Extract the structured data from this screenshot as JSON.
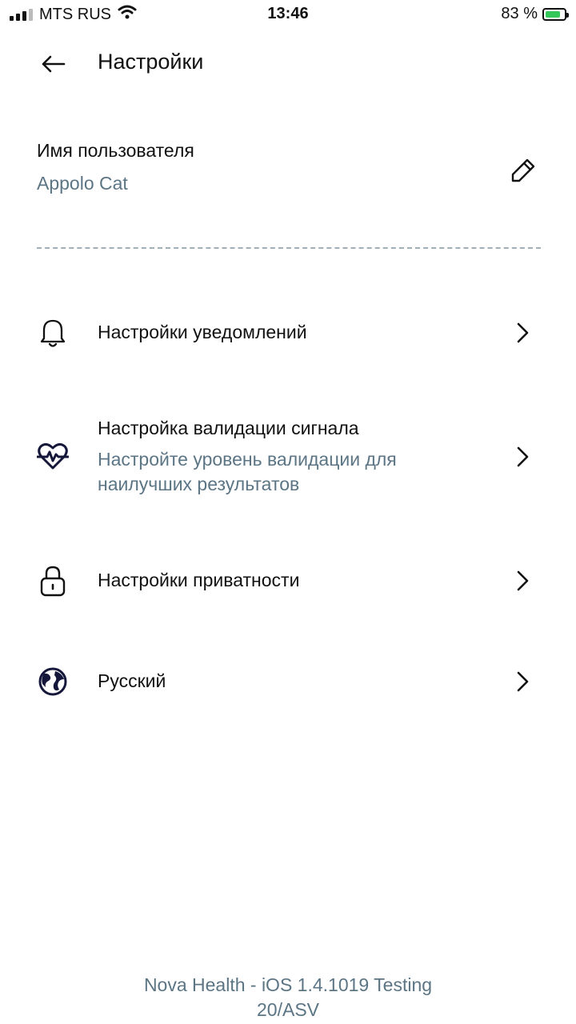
{
  "status_bar": {
    "carrier": "MTS RUS",
    "time": "13:46",
    "battery_percent": "83 %",
    "battery_level": 0.83
  },
  "header": {
    "title": "Настройки"
  },
  "user": {
    "label": "Имя пользователя",
    "value": "Appolo Cat"
  },
  "menu": {
    "notifications": {
      "title": "Настройки уведомлений",
      "icon": "bell-icon"
    },
    "signal": {
      "title": "Настройка валидации сигнала",
      "subtitle_line1": "Настройте уровень валидации для",
      "subtitle_line2": "наилучших результатов",
      "icon": "heart-pulse-icon"
    },
    "privacy": {
      "title": "Настройки приватности",
      "icon": "lock-icon"
    },
    "language": {
      "title": "Русский",
      "icon": "globe-icon"
    }
  },
  "footer": {
    "line1": "Nova Health - iOS 1.4.1019 Testing",
    "line2": "20/ASV"
  },
  "colors": {
    "text": "#111111",
    "secondary": "#5c7585",
    "icon_dark": "#14163a",
    "battery_fill": "#34c759"
  }
}
